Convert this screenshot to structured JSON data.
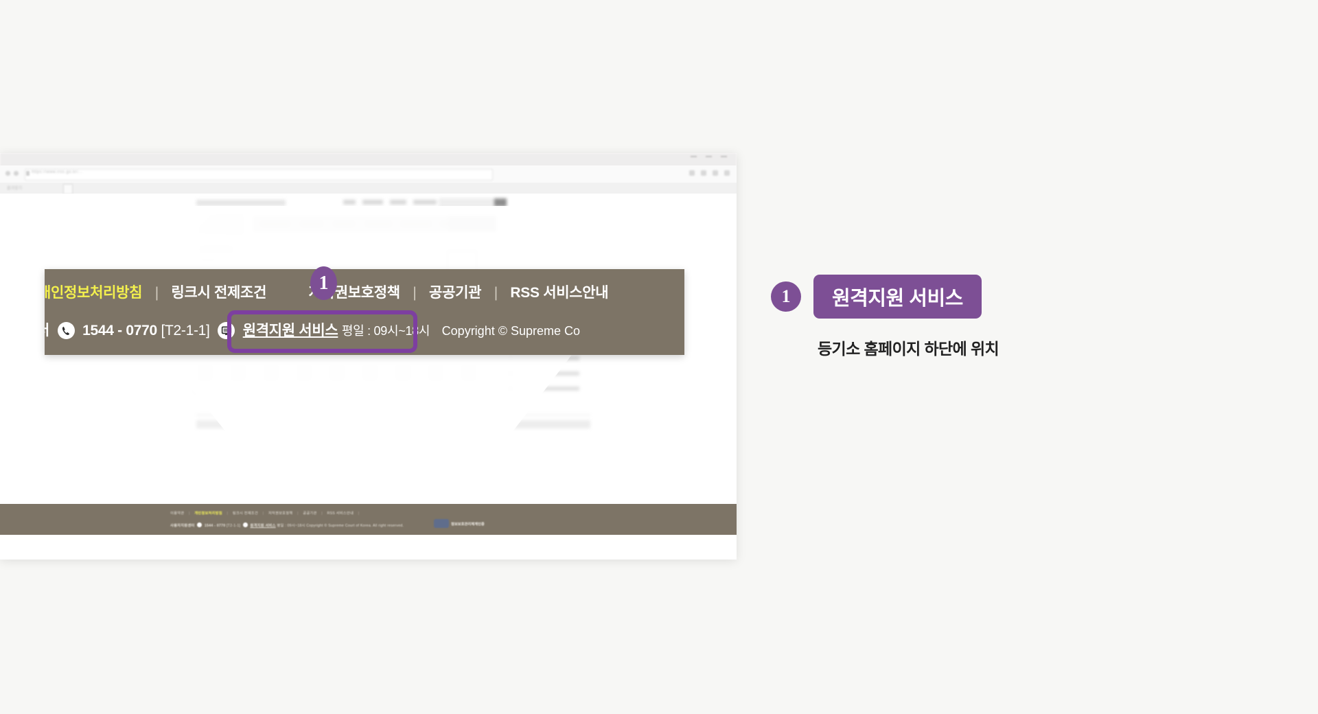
{
  "browser": {
    "url_text": "https://www.iros.go.kr/...",
    "bookmark_label": "즐겨찾기",
    "window_controls": [
      "minimize",
      "maximize",
      "close"
    ]
  },
  "site_footer": {
    "links": [
      "이용약관",
      "개인정보처리방침",
      "링크시 전제조건",
      "저작권보호정책",
      "공공기관",
      "RSS 서비스안내"
    ],
    "highlighted_link": "개인정보처리방침",
    "separator": "|",
    "certification_badge": {
      "mark": "ISMS",
      "label": "정보보호관리체계인증"
    },
    "support_label": "사용자지원센터",
    "phone_icon": "phone-icon",
    "phone": "1544 - 0770",
    "extension": "[T2-1-1]",
    "monitor_icon": "monitor-icon",
    "remote_link": "원격지원 서비스",
    "hours": "평일 : 09시~18시",
    "copyright": "Copyright © Supreme Court of Korea. All right reserved."
  },
  "callout": {
    "row1": {
      "link_cut": "개인정보처리방침",
      "link2": "링크시 전제조건",
      "link3": "저작권보호정책",
      "link4": "공공기관",
      "link5": "RSS 서비스안내",
      "separator": "|"
    },
    "row2": {
      "support_tail": "터",
      "phone_icon": "phone-icon",
      "phone": "1544 - 0770",
      "extension": "[T2-1-1]",
      "monitor_icon": "monitor-icon",
      "remote_link": "원격지원 서비스",
      "hours": "평일 : 09시~18시",
      "copyright": "Copyright © Supreme Co"
    },
    "badge_number": "1"
  },
  "annotation": {
    "badge_number": "1",
    "title": "원격지원 서비스",
    "description": "등기소 홈페이지 하단에 위치"
  },
  "colors": {
    "accent_purple": "#7d4f95",
    "highlight_purple": "#7d3fa0",
    "footer_brown": "#7d7466",
    "highlight_yellow": "#f4f14d",
    "page_background": "#f7f7f5"
  }
}
